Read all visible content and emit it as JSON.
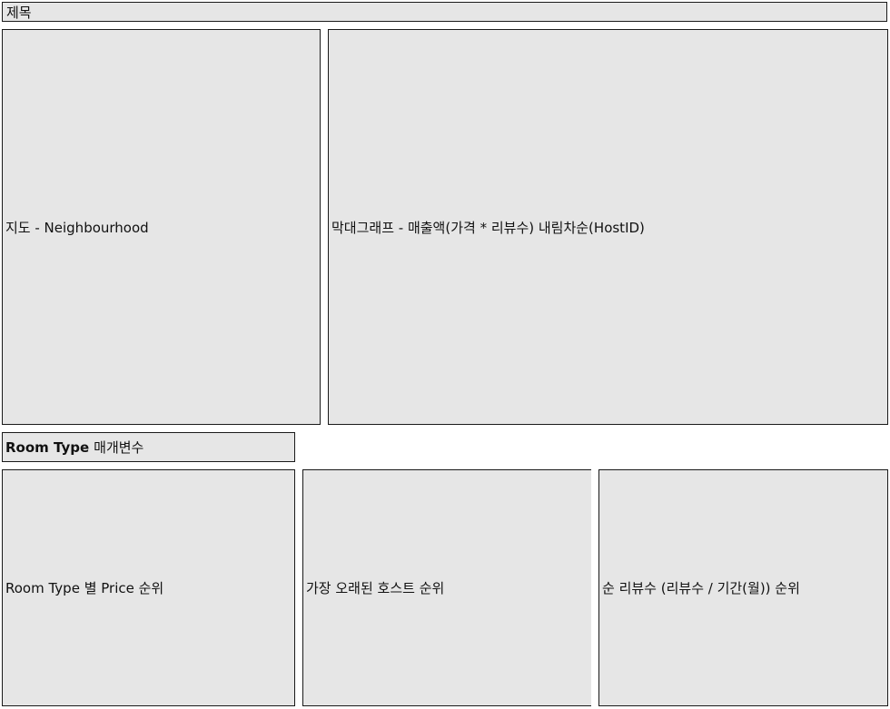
{
  "header": {
    "title": "제목"
  },
  "panels": {
    "map": {
      "label": "지도 - Neighbourhood"
    },
    "bar_chart": {
      "label": "막대그래프 - 매출액(가격 * 리뷰수) 내림차순(HostID)"
    },
    "room_type_filter": {
      "strong_label": "Room Type",
      "label": "매개변수"
    },
    "price_rank": {
      "label": "Room Type 별 Price 순위"
    },
    "oldest_host_rank": {
      "label": "가장 오래된 호스트 순위"
    },
    "review_rank": {
      "label": "순 리뷰수 (리뷰수 / 기간(월)) 순위"
    }
  },
  "colors": {
    "panel_background": "#e6e6e6",
    "panel_border": "#1a1a1a",
    "page_background": "#ffffff"
  }
}
